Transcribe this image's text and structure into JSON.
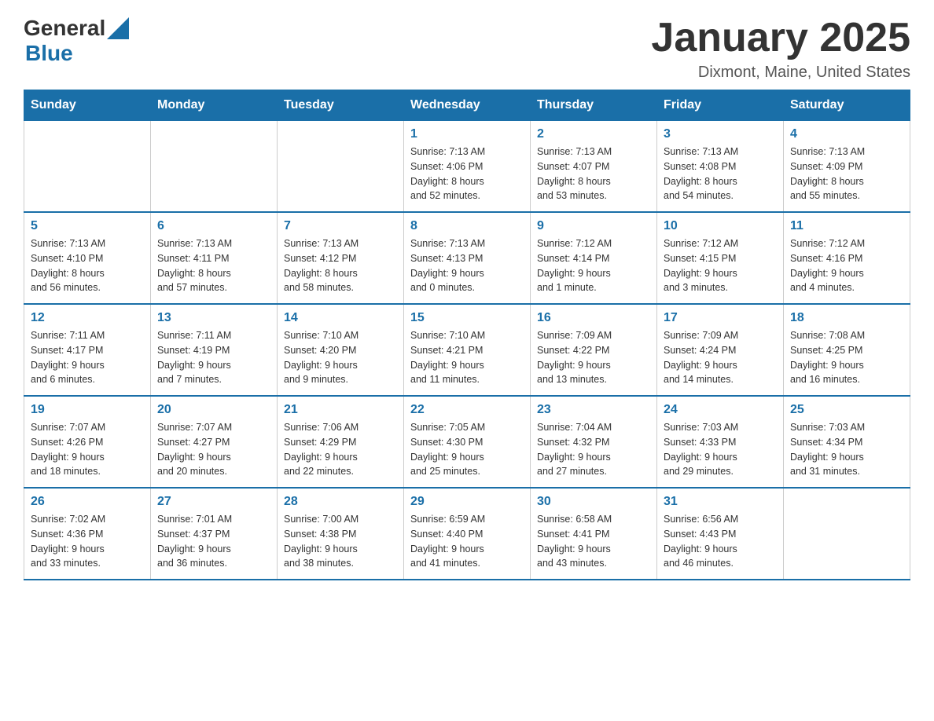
{
  "header": {
    "logo_general": "General",
    "logo_blue": "Blue",
    "month_title": "January 2025",
    "location": "Dixmont, Maine, United States"
  },
  "days_of_week": [
    "Sunday",
    "Monday",
    "Tuesday",
    "Wednesday",
    "Thursday",
    "Friday",
    "Saturday"
  ],
  "weeks": [
    [
      {
        "day": "",
        "info": ""
      },
      {
        "day": "",
        "info": ""
      },
      {
        "day": "",
        "info": ""
      },
      {
        "day": "1",
        "info": "Sunrise: 7:13 AM\nSunset: 4:06 PM\nDaylight: 8 hours\nand 52 minutes."
      },
      {
        "day": "2",
        "info": "Sunrise: 7:13 AM\nSunset: 4:07 PM\nDaylight: 8 hours\nand 53 minutes."
      },
      {
        "day": "3",
        "info": "Sunrise: 7:13 AM\nSunset: 4:08 PM\nDaylight: 8 hours\nand 54 minutes."
      },
      {
        "day": "4",
        "info": "Sunrise: 7:13 AM\nSunset: 4:09 PM\nDaylight: 8 hours\nand 55 minutes."
      }
    ],
    [
      {
        "day": "5",
        "info": "Sunrise: 7:13 AM\nSunset: 4:10 PM\nDaylight: 8 hours\nand 56 minutes."
      },
      {
        "day": "6",
        "info": "Sunrise: 7:13 AM\nSunset: 4:11 PM\nDaylight: 8 hours\nand 57 minutes."
      },
      {
        "day": "7",
        "info": "Sunrise: 7:13 AM\nSunset: 4:12 PM\nDaylight: 8 hours\nand 58 minutes."
      },
      {
        "day": "8",
        "info": "Sunrise: 7:13 AM\nSunset: 4:13 PM\nDaylight: 9 hours\nand 0 minutes."
      },
      {
        "day": "9",
        "info": "Sunrise: 7:12 AM\nSunset: 4:14 PM\nDaylight: 9 hours\nand 1 minute."
      },
      {
        "day": "10",
        "info": "Sunrise: 7:12 AM\nSunset: 4:15 PM\nDaylight: 9 hours\nand 3 minutes."
      },
      {
        "day": "11",
        "info": "Sunrise: 7:12 AM\nSunset: 4:16 PM\nDaylight: 9 hours\nand 4 minutes."
      }
    ],
    [
      {
        "day": "12",
        "info": "Sunrise: 7:11 AM\nSunset: 4:17 PM\nDaylight: 9 hours\nand 6 minutes."
      },
      {
        "day": "13",
        "info": "Sunrise: 7:11 AM\nSunset: 4:19 PM\nDaylight: 9 hours\nand 7 minutes."
      },
      {
        "day": "14",
        "info": "Sunrise: 7:10 AM\nSunset: 4:20 PM\nDaylight: 9 hours\nand 9 minutes."
      },
      {
        "day": "15",
        "info": "Sunrise: 7:10 AM\nSunset: 4:21 PM\nDaylight: 9 hours\nand 11 minutes."
      },
      {
        "day": "16",
        "info": "Sunrise: 7:09 AM\nSunset: 4:22 PM\nDaylight: 9 hours\nand 13 minutes."
      },
      {
        "day": "17",
        "info": "Sunrise: 7:09 AM\nSunset: 4:24 PM\nDaylight: 9 hours\nand 14 minutes."
      },
      {
        "day": "18",
        "info": "Sunrise: 7:08 AM\nSunset: 4:25 PM\nDaylight: 9 hours\nand 16 minutes."
      }
    ],
    [
      {
        "day": "19",
        "info": "Sunrise: 7:07 AM\nSunset: 4:26 PM\nDaylight: 9 hours\nand 18 minutes."
      },
      {
        "day": "20",
        "info": "Sunrise: 7:07 AM\nSunset: 4:27 PM\nDaylight: 9 hours\nand 20 minutes."
      },
      {
        "day": "21",
        "info": "Sunrise: 7:06 AM\nSunset: 4:29 PM\nDaylight: 9 hours\nand 22 minutes."
      },
      {
        "day": "22",
        "info": "Sunrise: 7:05 AM\nSunset: 4:30 PM\nDaylight: 9 hours\nand 25 minutes."
      },
      {
        "day": "23",
        "info": "Sunrise: 7:04 AM\nSunset: 4:32 PM\nDaylight: 9 hours\nand 27 minutes."
      },
      {
        "day": "24",
        "info": "Sunrise: 7:03 AM\nSunset: 4:33 PM\nDaylight: 9 hours\nand 29 minutes."
      },
      {
        "day": "25",
        "info": "Sunrise: 7:03 AM\nSunset: 4:34 PM\nDaylight: 9 hours\nand 31 minutes."
      }
    ],
    [
      {
        "day": "26",
        "info": "Sunrise: 7:02 AM\nSunset: 4:36 PM\nDaylight: 9 hours\nand 33 minutes."
      },
      {
        "day": "27",
        "info": "Sunrise: 7:01 AM\nSunset: 4:37 PM\nDaylight: 9 hours\nand 36 minutes."
      },
      {
        "day": "28",
        "info": "Sunrise: 7:00 AM\nSunset: 4:38 PM\nDaylight: 9 hours\nand 38 minutes."
      },
      {
        "day": "29",
        "info": "Sunrise: 6:59 AM\nSunset: 4:40 PM\nDaylight: 9 hours\nand 41 minutes."
      },
      {
        "day": "30",
        "info": "Sunrise: 6:58 AM\nSunset: 4:41 PM\nDaylight: 9 hours\nand 43 minutes."
      },
      {
        "day": "31",
        "info": "Sunrise: 6:56 AM\nSunset: 4:43 PM\nDaylight: 9 hours\nand 46 minutes."
      },
      {
        "day": "",
        "info": ""
      }
    ]
  ]
}
